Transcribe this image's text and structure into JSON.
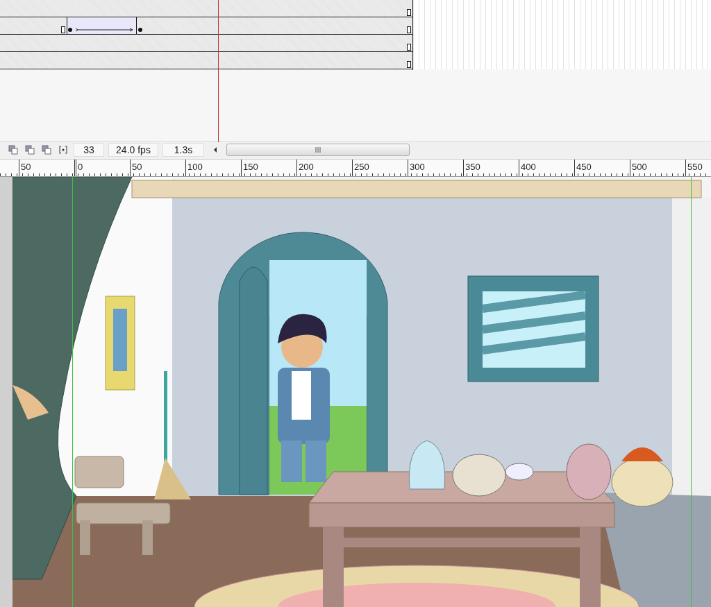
{
  "timeline": {
    "layers": [
      {
        "tween": false
      },
      {
        "tween": true
      },
      {
        "tween": false
      },
      {
        "tween": false
      }
    ]
  },
  "toolbar": {
    "current_frame": "33",
    "frame_rate": "24.0 fps",
    "elapsed_time": "1.3s"
  },
  "ruler": {
    "labels": [
      "50",
      "0",
      "50",
      "100",
      "150",
      "200",
      "250",
      "300",
      "350",
      "400",
      "450",
      "500",
      "550"
    ]
  }
}
